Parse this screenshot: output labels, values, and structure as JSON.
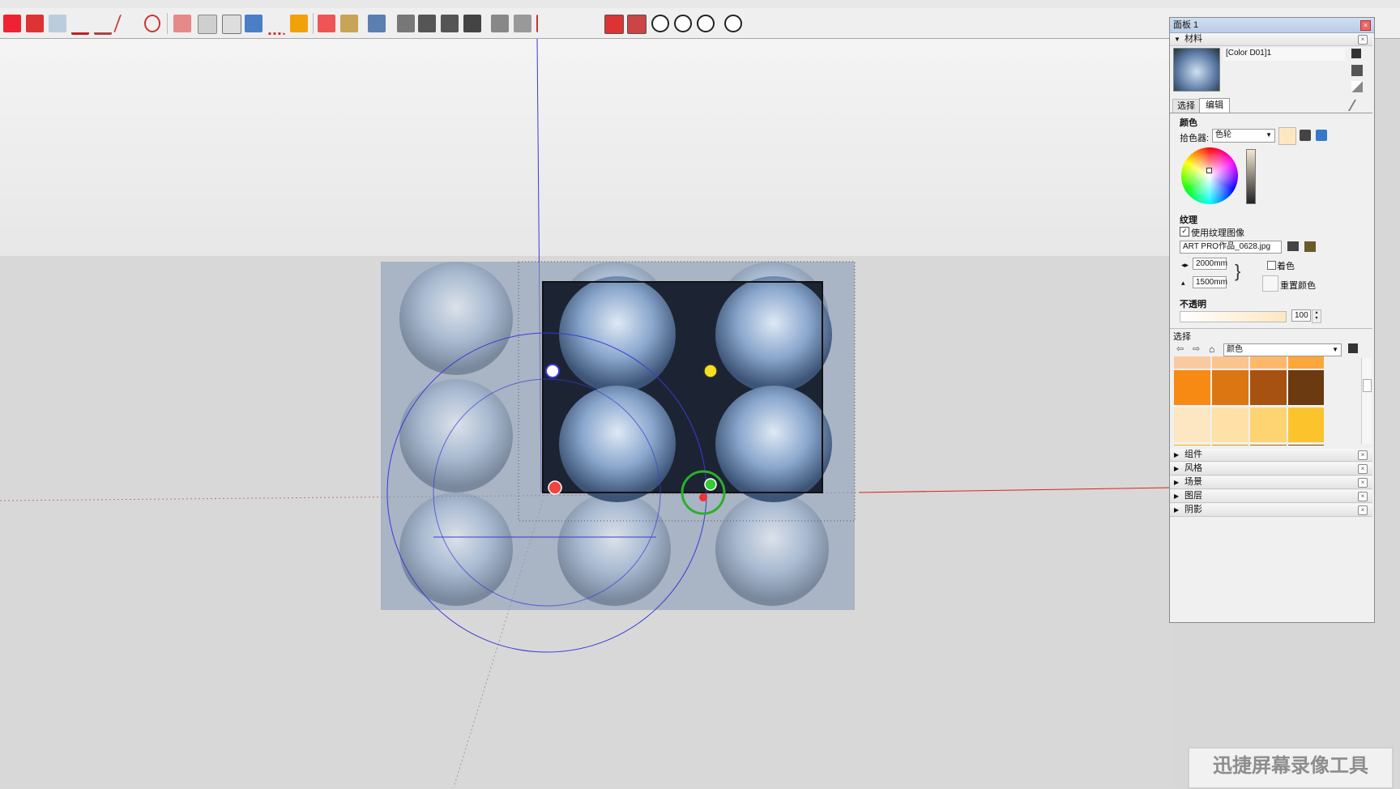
{
  "panel": {
    "title": "面板 1",
    "materials_header": "材料",
    "material_name": "[Color D01]1",
    "tabs": [
      "选择",
      "编辑"
    ],
    "color_section": "颜色",
    "picker_label": "拾色器:",
    "picker_value": "色轮",
    "texture_section": "纹理",
    "use_texture_label": "使用纹理图像",
    "texture_file": "ART PRO作品_0628.jpg",
    "width_value": "2000mm",
    "height_value": "1500mm",
    "colorize_label": "着色",
    "reset_color_label": "重置颜色",
    "opacity_section": "不透明",
    "opacity_value": "100",
    "select_section": "选择",
    "select_dropdown": "颜色",
    "collapsed_sections": [
      "组件",
      "风格",
      "场景",
      "图层",
      "阴影"
    ],
    "swatch_colors": [
      "#f9c9a0",
      "#fbc48e",
      "#fdb86b",
      "#fba73c",
      "#f68a12",
      "#dc7612",
      "#a85212",
      "#6b3a10",
      "#fde7c2",
      "#fde1a6",
      "#fdd471",
      "#fbc42d",
      "#f4b000",
      "#d99d00",
      "#a17300",
      "#6f5000"
    ]
  },
  "watermark": "迅捷屏幕录像工具",
  "colors": {
    "axis_blue": "#3a3ad8",
    "axis_red": "#d22",
    "panel_bg": "#f0f0f0"
  }
}
